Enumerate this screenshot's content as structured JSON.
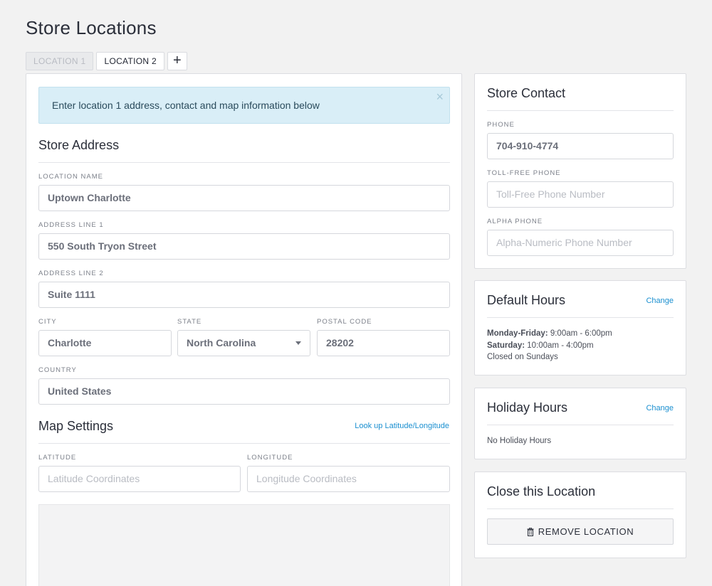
{
  "page": {
    "title": "Store Locations"
  },
  "tabs": [
    {
      "label": "LOCATION 1",
      "active": false
    },
    {
      "label": "LOCATION 2",
      "active": true
    },
    {
      "label": "+",
      "icon": "plus-icon"
    }
  ],
  "alert": {
    "text": "Enter location 1 address, contact and map information below",
    "close_glyph": "×"
  },
  "address": {
    "title": "Store Address",
    "location_name": {
      "label": "LOCATION NAME",
      "value": "Uptown Charlotte"
    },
    "address_line_1": {
      "label": "ADDRESS LINE 1",
      "value": "550 South Tryon Street"
    },
    "address_line_2": {
      "label": "ADDRESS LINE 2",
      "value": "Suite 1111"
    },
    "city": {
      "label": "CITY",
      "value": "Charlotte"
    },
    "state": {
      "label": "STATE",
      "value": "North Carolina"
    },
    "postal_code": {
      "label": "POSTAL CODE",
      "value": "28202"
    },
    "country": {
      "label": "COUNTRY",
      "value": "United States"
    }
  },
  "map": {
    "title": "Map Settings",
    "lookup_link": "Look up Latitude/Longitude",
    "latitude": {
      "label": "LATITUDE",
      "placeholder": "Latitude Coordinates"
    },
    "longitude": {
      "label": "LONGITUDE",
      "placeholder": "Longitude Coordinates"
    }
  },
  "contact": {
    "title": "Store Contact",
    "phone": {
      "label": "PHONE",
      "value": "704-910-4774"
    },
    "toll_free": {
      "label": "TOLL-FREE PHONE",
      "placeholder": "Toll-Free Phone Number"
    },
    "alpha": {
      "label": "ALPHA PHONE",
      "placeholder": "Alpha-Numeric Phone Number"
    }
  },
  "default_hours": {
    "title": "Default Hours",
    "change_link": "Change",
    "weekday_label": "Monday-Friday:",
    "weekday_hours": "9:00am - 6:00pm",
    "saturday_label": "Saturday:",
    "saturday_hours": "10:00am - 4:00pm",
    "sunday_text": "Closed on Sundays"
  },
  "holiday_hours": {
    "title": "Holiday Hours",
    "change_link": "Change",
    "text": "No Holiday Hours"
  },
  "close_location": {
    "title": "Close this Location",
    "button_label": "REMOVE LOCATION",
    "button_icon": "trash-icon"
  }
}
